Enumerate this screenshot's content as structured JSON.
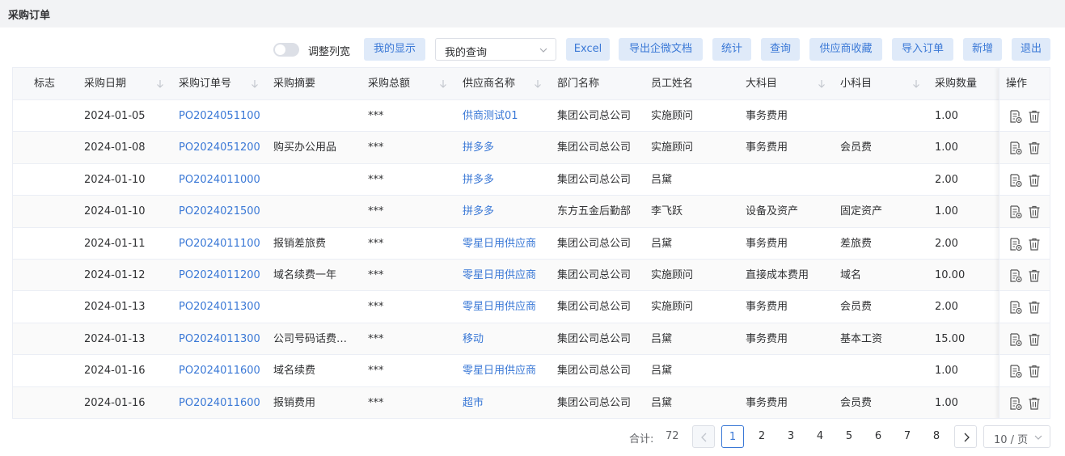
{
  "page": {
    "title": "采购订单"
  },
  "toolbar": {
    "toggle_label": "调整列宽",
    "toggle_on": false,
    "query_select": {
      "value": "我的查询"
    },
    "buttons": [
      {
        "id": "my-display",
        "label": "我的显示"
      },
      {
        "id": "excel",
        "label": "Excel"
      },
      {
        "id": "export-wecom",
        "label": "导出企微文档"
      },
      {
        "id": "stats",
        "label": "统计"
      },
      {
        "id": "query",
        "label": "查询"
      },
      {
        "id": "supplier-fav",
        "label": "供应商收藏"
      },
      {
        "id": "import-order",
        "label": "导入订单"
      },
      {
        "id": "add",
        "label": "新增"
      },
      {
        "id": "exit",
        "label": "退出"
      }
    ]
  },
  "table": {
    "columns": [
      {
        "key": "flag",
        "label": "标志",
        "sortable": false
      },
      {
        "key": "date",
        "label": "采购日期",
        "sortable": true
      },
      {
        "key": "order_no",
        "label": "采购订单号",
        "sortable": true
      },
      {
        "key": "summary",
        "label": "采购摘要",
        "sortable": false
      },
      {
        "key": "amount",
        "label": "采购总额",
        "sortable": true
      },
      {
        "key": "supplier",
        "label": "供应商名称",
        "sortable": true
      },
      {
        "key": "dept",
        "label": "部门名称",
        "sortable": false
      },
      {
        "key": "employee",
        "label": "员工姓名",
        "sortable": false
      },
      {
        "key": "major",
        "label": "大科目",
        "sortable": true
      },
      {
        "key": "minor",
        "label": "小科目",
        "sortable": true
      },
      {
        "key": "qty",
        "label": "采购数量",
        "sortable": false
      },
      {
        "key": "ops",
        "label": "操作",
        "sortable": false
      }
    ],
    "rows": [
      {
        "flag": "",
        "date": "2024-01-05",
        "order_no": "PO2024051100",
        "summary": "",
        "amount": "***",
        "supplier": "供商测试01",
        "dept": "集团公司总公司",
        "employee": "实施顾问",
        "major": "事务费用",
        "minor": "",
        "qty": "1.00"
      },
      {
        "flag": "",
        "date": "2024-01-08",
        "order_no": "PO2024051200",
        "summary": "购买办公用品",
        "amount": "***",
        "supplier": "拼多多",
        "dept": "集团公司总公司",
        "employee": "实施顾问",
        "major": "事务费用",
        "minor": "会员费",
        "qty": "1.00"
      },
      {
        "flag": "",
        "date": "2024-01-10",
        "order_no": "PO2024011000",
        "summary": "",
        "amount": "***",
        "supplier": "拼多多",
        "dept": "集团公司总公司",
        "employee": "吕黛",
        "major": "",
        "minor": "",
        "qty": "2.00"
      },
      {
        "flag": "",
        "date": "2024-01-10",
        "order_no": "PO2024021500",
        "summary": "",
        "amount": "***",
        "supplier": "拼多多",
        "dept": "东方五金后勤部",
        "employee": "李飞跃",
        "major": "设备及资产",
        "minor": "固定资产",
        "qty": "1.00"
      },
      {
        "flag": "",
        "date": "2024-01-11",
        "order_no": "PO2024011100",
        "summary": "报销差旅费",
        "amount": "***",
        "supplier": "零星日用供应商",
        "dept": "集团公司总公司",
        "employee": "吕黛",
        "major": "事务费用",
        "minor": "差旅费",
        "qty": "2.00"
      },
      {
        "flag": "",
        "date": "2024-01-12",
        "order_no": "PO2024011200",
        "summary": "域名续费一年",
        "amount": "***",
        "supplier": "零星日用供应商",
        "dept": "集团公司总公司",
        "employee": "实施顾问",
        "major": "直接成本费用",
        "minor": "域名",
        "qty": "10.00"
      },
      {
        "flag": "",
        "date": "2024-01-13",
        "order_no": "PO2024011300",
        "summary": "",
        "amount": "***",
        "supplier": "零星日用供应商",
        "dept": "集团公司总公司",
        "employee": "实施顾问",
        "major": "事务费用",
        "minor": "会员费",
        "qty": "2.00"
      },
      {
        "flag": "",
        "date": "2024-01-13",
        "order_no": "PO2024011300",
        "summary": "公司号码话费…",
        "amount": "***",
        "supplier": "移动",
        "dept": "集团公司总公司",
        "employee": "吕黛",
        "major": "事务费用",
        "minor": "基本工资",
        "qty": "15.00"
      },
      {
        "flag": "",
        "date": "2024-01-16",
        "order_no": "PO2024011600",
        "summary": "域名续费",
        "amount": "***",
        "supplier": "零星日用供应商",
        "dept": "集团公司总公司",
        "employee": "吕黛",
        "major": "",
        "minor": "",
        "qty": "1.00"
      },
      {
        "flag": "",
        "date": "2024-01-16",
        "order_no": "PO2024011600",
        "summary": "报销费用",
        "amount": "***",
        "supplier": "超市",
        "dept": "集团公司总公司",
        "employee": "吕黛",
        "major": "事务费用",
        "minor": "会员费",
        "qty": "1.00"
      }
    ],
    "row_actions": [
      {
        "id": "view",
        "icon": "document-view-icon"
      },
      {
        "id": "delete",
        "icon": "trash-icon"
      }
    ]
  },
  "pagination": {
    "total_label": "合计:",
    "total": "72",
    "pages": [
      "1",
      "2",
      "3",
      "4",
      "5",
      "6",
      "7",
      "8"
    ],
    "current": "1",
    "page_size_label": "10 / 页"
  },
  "colors": {
    "accent": "#3a78d6",
    "button_bg": "#dfeaf9",
    "header_bg": "#f2f3f5",
    "table_header_bg": "#f7f8fa",
    "border": "#ebeef5"
  }
}
